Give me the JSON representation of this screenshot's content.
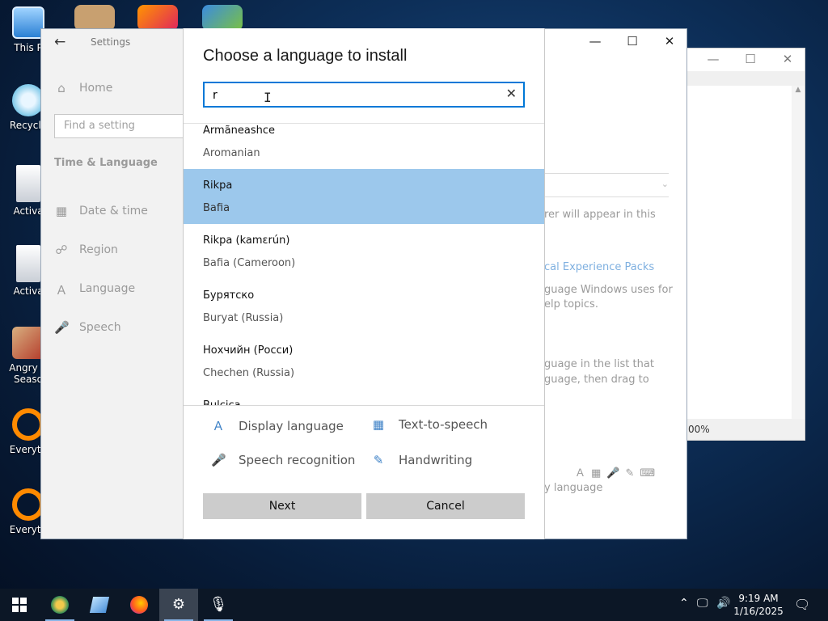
{
  "desktop": {
    "icons": [
      {
        "label": "This P",
        "icon": "computer-icon"
      },
      {
        "label": "Recycle",
        "icon": "recycle-bin-icon"
      },
      {
        "label": "Activa",
        "icon": "file-icon"
      },
      {
        "label": "Activa",
        "icon": "file-icon"
      },
      {
        "label": "Angry B\nSeaso",
        "icon": "angry-birds-icon"
      },
      {
        "label": "Everyth",
        "icon": "search-app-icon"
      },
      {
        "label": "Everyth",
        "icon": "search-app-icon"
      }
    ]
  },
  "bg_window": {
    "status": "00%"
  },
  "settings": {
    "title": "Settings",
    "home": "Home",
    "find_placeholder": "Find a setting",
    "section": "Time & Language",
    "nav": [
      {
        "label": "Date & time",
        "icon": "calendar-icon"
      },
      {
        "label": "Region",
        "icon": "globe-icon"
      },
      {
        "label": "Language",
        "icon": "language-icon"
      },
      {
        "label": "Speech",
        "icon": "microphone-icon"
      }
    ],
    "right_text": {
      "line1": "rer will appear in this",
      "link": "cal Experience Packs",
      "para1_l1": "guage Windows uses for",
      "para1_l2": "elp topics.",
      "para2_l1": "guage in the list that",
      "para2_l2": "guage, then drag to",
      "footer": "y language"
    }
  },
  "dialog": {
    "title": "Choose a language to install",
    "search_value": "r",
    "languages": [
      {
        "native": "Armãneashce",
        "english": "Aromanian",
        "selected": false
      },
      {
        "native": "Rikpa",
        "english": "Bafia",
        "selected": true
      },
      {
        "native": "Rikpa (kamɛrún)",
        "english": "Bafia (Cameroon)",
        "selected": false
      },
      {
        "native": "Бурятско",
        "english": "Buryat (Russia)",
        "selected": false
      },
      {
        "native": "Нохчийн (Росси)",
        "english": "Chechen (Russia)",
        "selected": false
      },
      {
        "native": "Bulcica",
        "english": "",
        "selected": false
      }
    ],
    "features": {
      "display_language": "Display language",
      "text_to_speech": "Text-to-speech",
      "speech_recognition": "Speech recognition",
      "handwriting": "Handwriting"
    },
    "next_label": "Next",
    "cancel_label": "Cancel"
  },
  "taskbar": {
    "time": "9:19 AM",
    "date": "1/16/2025"
  }
}
